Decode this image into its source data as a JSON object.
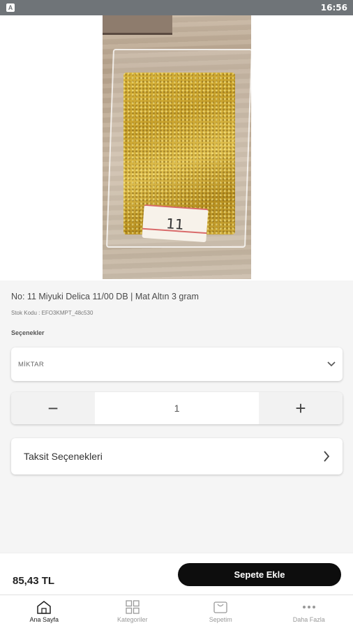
{
  "status_bar": {
    "time": "16:56",
    "app_badge": "A"
  },
  "product": {
    "title": "No: 11 Miyuki Delica 11/00 DB | Mat Altın 3 gram",
    "sku": "Stok Kodu : EFO3KMPT_48c530",
    "photo_tag": "11"
  },
  "options": {
    "label": "Seçenekler",
    "select_value": "MİKTAR"
  },
  "quantity": {
    "value": "1",
    "minus": "−",
    "plus": "+"
  },
  "installments": {
    "label": "Taksit Seçenekleri"
  },
  "cart": {
    "price": "85,43 TL",
    "add_button": "Sepete Ekle"
  },
  "tabs": [
    {
      "label": "Ana Sayfa",
      "icon": "home-icon",
      "active": true
    },
    {
      "label": "Kategoriler",
      "icon": "grid-icon",
      "active": false
    },
    {
      "label": "Sepetim",
      "icon": "cart-icon",
      "active": false
    },
    {
      "label": "Daha Fazla",
      "icon": "more-icon",
      "active": false
    }
  ],
  "colors": {
    "accent": "#0d0d0d",
    "status_bar": "#6f7478",
    "background": "#f5f5f5"
  }
}
